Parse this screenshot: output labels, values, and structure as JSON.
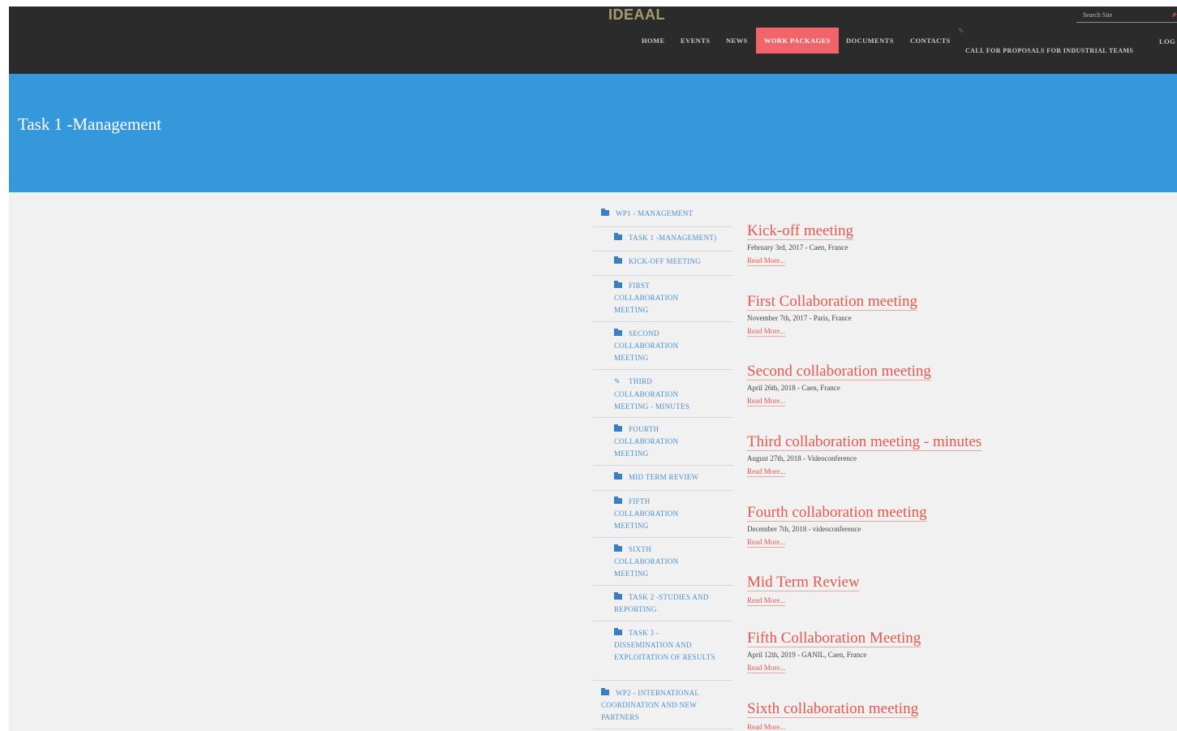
{
  "site": {
    "logo": "IDEAAL"
  },
  "search": {
    "placeholder": "Search Site",
    "icon": "search-icon"
  },
  "nav": {
    "items": [
      {
        "label": "HOME"
      },
      {
        "label": "EVENTS"
      },
      {
        "label": "NEWS"
      },
      {
        "label": "WORK PACKAGES"
      },
      {
        "label": "DOCUMENTS"
      },
      {
        "label": "CONTACTS"
      }
    ],
    "active": "WORK PACKAGES",
    "call_for_proposals": "CALL FOR PROPOSALS FOR INDUSTRIAL TEAMS",
    "login": "LOG"
  },
  "banner": {
    "title": "Task 1 -Management"
  },
  "sidebar": {
    "items": [
      {
        "label": "WP1 - MANAGEMENT",
        "icon": "folder-icon"
      },
      {
        "label": "TASK 1 -MANAGEMENT)",
        "icon": "folder-icon"
      },
      {
        "label": "KICK-OFF MEETING",
        "icon": "folder-icon"
      },
      {
        "label": "FIRST COLLABORATION MEETING",
        "icon": "folder-icon"
      },
      {
        "label": "SECOND COLLABORATION MEETING",
        "icon": "folder-icon"
      },
      {
        "label": "THIRD COLLABORATION MEETING - MINUTES",
        "icon": "pencil-icon"
      },
      {
        "label": "FOURTH COLLABORATION MEETING",
        "icon": "folder-icon"
      },
      {
        "label": "MID TERM REVIEW",
        "icon": "folder-icon"
      },
      {
        "label": "FIFTH COLLABORATION MEETING",
        "icon": "folder-icon"
      },
      {
        "label": "SIXTH COLLABORATION MEETING",
        "icon": "folder-icon"
      },
      {
        "label": "TASK 2 -STUDIES AND REPORTING",
        "icon": "folder-icon"
      },
      {
        "label": "TASK 3 -DISSEMINATION AND EXPLOITATION OF RESULTS",
        "icon": "folder-icon"
      },
      {
        "label": "WP2 - INTERNATIONAL COORDINATION AND NEW PARTNERS",
        "icon": "folder-icon"
      }
    ]
  },
  "articles": [
    {
      "title": "Kick-off meeting",
      "meta": "February 3rd, 2017 - Caen, France",
      "more": "Read More..."
    },
    {
      "title": "First Collaboration meeting",
      "meta": "November 7th, 2017 - Paris, France",
      "more": "Read More..."
    },
    {
      "title": "Second collaboration meeting",
      "meta": "April 26th, 2018 - Caen, France",
      "more": "Read More..."
    },
    {
      "title": "Third collaboration meeting - minutes",
      "meta": "August 27th, 2018 - Videoconference",
      "more": "Read More..."
    },
    {
      "title": "Fourth collaboration meeting",
      "meta": "December 7th, 2018 - videoconference",
      "more": "Read More..."
    },
    {
      "title": "Mid Term Review",
      "meta": "",
      "more": "Read More..."
    },
    {
      "title": "Fifth Collaboration Meeting",
      "meta": "April 12th, 2019 - GANIL, Caen, France",
      "more": "Read More..."
    },
    {
      "title": "Sixth collaboration meeting",
      "meta": "",
      "more": "Read More..."
    }
  ],
  "colors": {
    "accent": "#e8564d",
    "banner": "#3598db",
    "topbar": "#2b2b2b",
    "nav_active": "#f0646a",
    "link": "#4a8fcf"
  }
}
